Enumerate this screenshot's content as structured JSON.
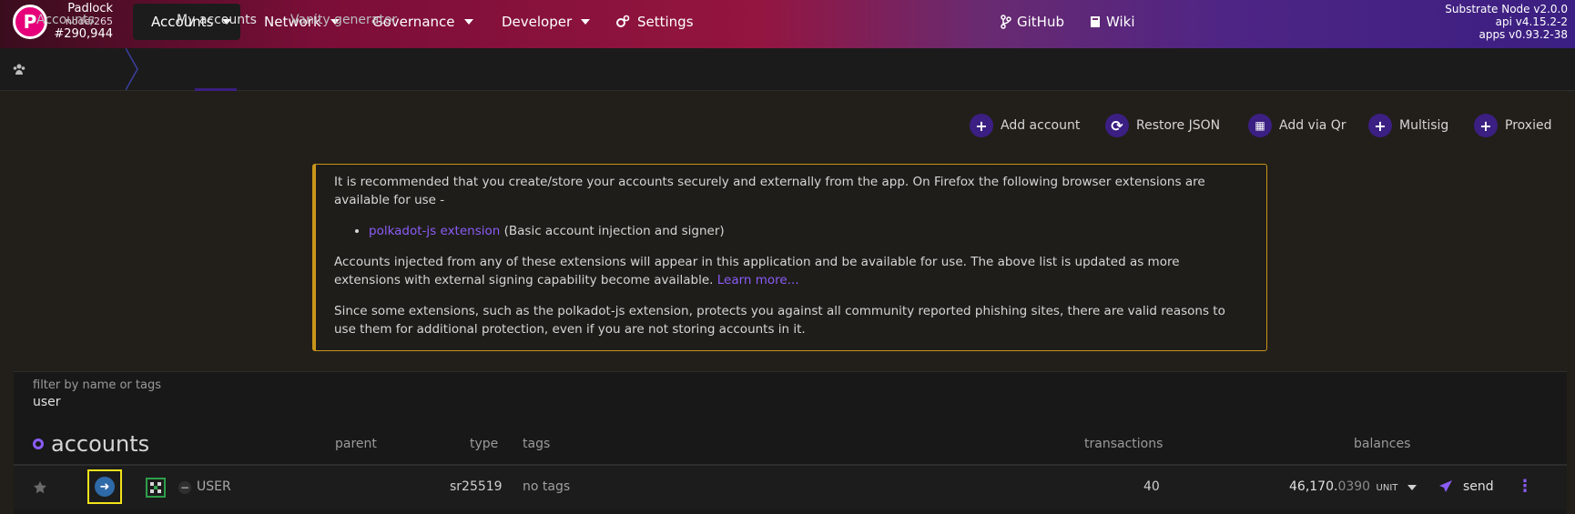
{
  "header": {
    "logo_letter": "P",
    "chain_name": "Padlock",
    "node": "node/265",
    "block": "#290,944",
    "nav": [
      "Accounts",
      "Network",
      "Governance",
      "Developer",
      "Settings"
    ],
    "links": [
      "GitHub",
      "Wiki"
    ],
    "version": [
      "Substrate Node v2.0.0",
      "api v4.15.2-2",
      "apps v0.93.2-38"
    ]
  },
  "subnav": {
    "section": "Accounts",
    "tabs": [
      "My accounts",
      "Vanity generator"
    ]
  },
  "actions": [
    "Add account",
    "Restore JSON",
    "Add via Qr",
    "Multisig",
    "Proxied"
  ],
  "notice": {
    "p1": "It is recommended that you create/store your accounts securely and externally from the app. On Firefox the following browser extensions are available for use -",
    "ext_link": "polkadot-js extension",
    "ext_desc": " (Basic account injection and signer)",
    "p2": "Accounts injected from any of these extensions will appear in this application and be available for use. The above list is updated as more extensions with external signing capability become available.",
    "learn_more": "Learn more...",
    "p3": "Since some extensions, such as the polkadot-js extension, protects you against all community reported phishing sites, there are valid reasons to use them for additional protection, even if you are not storing accounts in it."
  },
  "filter": {
    "label": "filter by name or tags",
    "value": "user"
  },
  "table": {
    "title": "accounts",
    "headers": {
      "parent": "parent",
      "type": "type",
      "tags": "tags",
      "transactions": "transactions",
      "balances": "balances"
    },
    "row": {
      "name": "USER",
      "type": "sr25519",
      "tags": "no tags",
      "transactions": "40",
      "balance_main": "46,170.",
      "balance_dec": "0390",
      "unit": "UNIT",
      "send": "send"
    }
  },
  "colors": {
    "accent": "#8a5cf6",
    "notice_border": "#c8941a",
    "highlight": "#f2e31a"
  }
}
